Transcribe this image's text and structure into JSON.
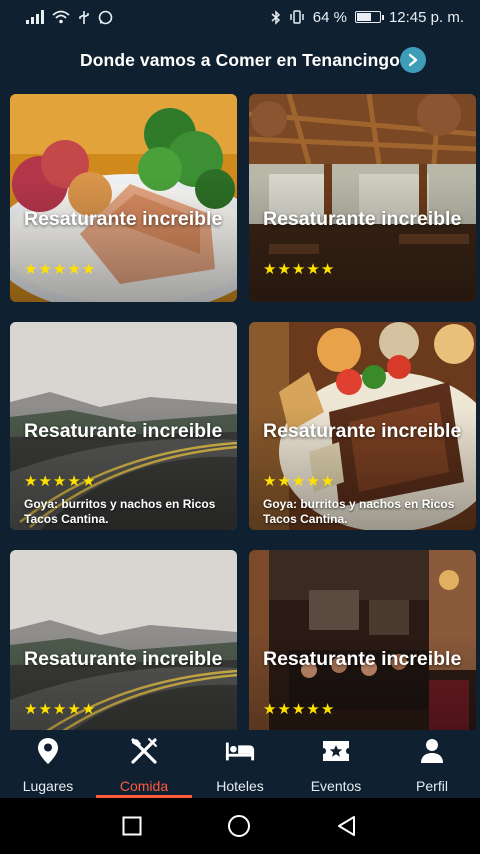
{
  "status_bar": {
    "battery": "64 %",
    "battery_level": 0.64,
    "time": "12:45 p. m."
  },
  "header": {
    "title": "Donde vamos a Comer en Tenancingo",
    "arrow_icon": "chevron-right-icon"
  },
  "cards": [
    {
      "title": "Resaturante increible",
      "rating": 5,
      "description": "",
      "image": "food-plate-image"
    },
    {
      "title": "Resaturante increible",
      "rating": 5,
      "description": "",
      "image": "restaurant-interior-image"
    },
    {
      "title": "Resaturante increible",
      "rating": 5,
      "description": "Goya: burritos y nachos en Ricos Tacos Cantina.",
      "image": "road-landscape-image"
    },
    {
      "title": "Resaturante increible",
      "rating": 5,
      "description": "Goya: burritos y nachos en Ricos Tacos Cantina.",
      "image": "grilled-meat-plate-image"
    },
    {
      "title": "Resaturante increible",
      "rating": 5,
      "description": "",
      "image": "road-landscape-image"
    },
    {
      "title": "Resaturante increible",
      "rating": 5,
      "description": "",
      "image": "bar-interior-image"
    }
  ],
  "nav": {
    "items": [
      {
        "label": "Lugares",
        "icon": "location-pin-icon",
        "active": false
      },
      {
        "label": "Comida",
        "icon": "fork-knife-icon",
        "active": true
      },
      {
        "label": "Hoteles",
        "icon": "bed-icon",
        "active": false
      },
      {
        "label": "Eventos",
        "icon": "ticket-star-icon",
        "active": false
      },
      {
        "label": "Perfil",
        "icon": "person-icon",
        "active": false
      }
    ],
    "active_color": "#ff5a3c"
  },
  "colors": {
    "background": "#0f2030",
    "accent": "#3e9db9",
    "star": "#ffe100"
  }
}
